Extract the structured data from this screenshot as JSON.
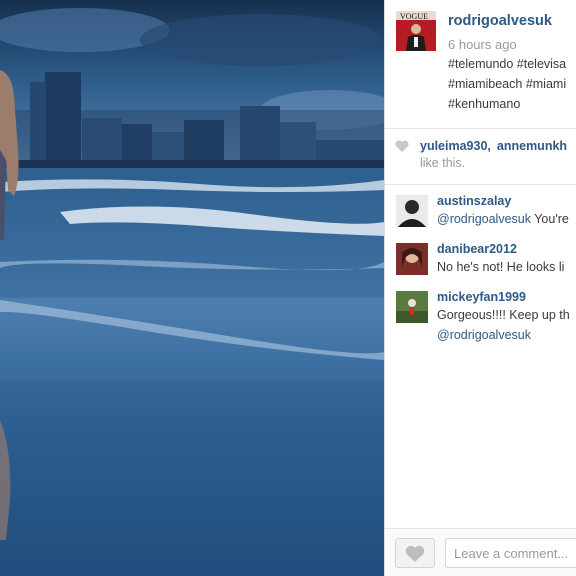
{
  "post": {
    "username": "rodrigoalvesuk",
    "timestamp": "6 hours ago",
    "caption_lines": [
      "#telemundo #televisa",
      "#miamibeach #miami",
      "#kenhumano"
    ]
  },
  "likes": {
    "likers": [
      "yuleima930,",
      "annemunkh"
    ],
    "suffix": "like this."
  },
  "comments": [
    {
      "user": "austinszalay",
      "mention": "@rodrigoalvesuk",
      "text": " You're"
    },
    {
      "user": "danibear2012",
      "text": "No he's not! He looks li"
    },
    {
      "user": "mickeyfan1999",
      "text": "Gorgeous!!!! Keep up th",
      "mention_line2": "@rodrigoalvesuk"
    }
  ],
  "footer": {
    "comment_placeholder": "Leave a comment..."
  },
  "icons": {
    "like": "heart-icon",
    "like_button": "heart-icon"
  },
  "colors": {
    "username": "#2d5a86",
    "muted": "#9a9a9a",
    "avatar_red": "#b61c22"
  }
}
